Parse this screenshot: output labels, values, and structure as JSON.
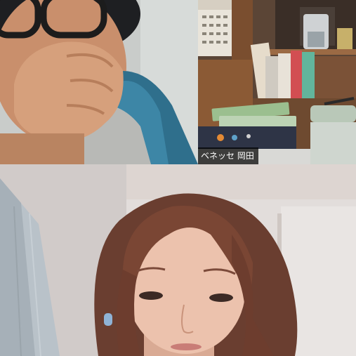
{
  "call": {
    "participants": [
      {
        "position": "top-left",
        "name": ""
      },
      {
        "position": "top-right",
        "name": "ベネッセ 岡田"
      },
      {
        "position": "bottom",
        "name": ""
      }
    ]
  },
  "colors": {
    "tile_border": "#111111",
    "name_tag_background": "#000000",
    "name_tag_text": "#ffffff"
  }
}
